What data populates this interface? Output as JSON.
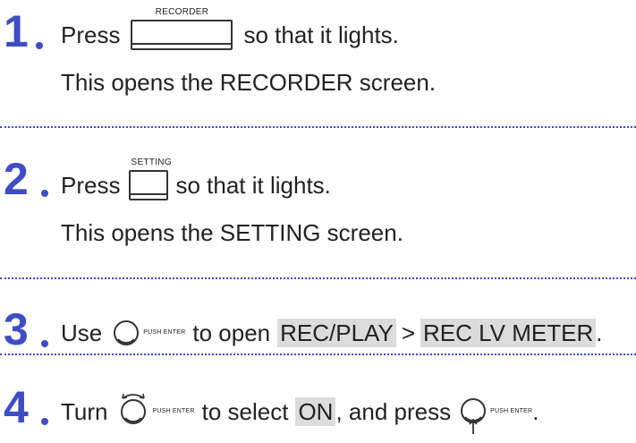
{
  "steps": [
    {
      "number": "1",
      "verb": "Press",
      "button_caption": "RECORDER",
      "suffix": "so that it lights.",
      "detail": "This opens the RECORDER screen."
    },
    {
      "number": "2",
      "verb": "Press",
      "button_caption": "SETTING",
      "suffix": "so that it lights.",
      "detail": "This opens the SETTING screen."
    },
    {
      "number": "3",
      "verb": "Use",
      "knob_caption": "PUSH ENTER",
      "middle": "to open",
      "menu_1": "REC/PLAY",
      "arrow": ">",
      "menu_2": "REC LV METER",
      "end": "."
    },
    {
      "number": "4",
      "verb": "Turn",
      "knob_caption": "PUSH ENTER",
      "middle": "to select",
      "option": "ON",
      "after_option": ", and press",
      "knob2_caption": "PUSH ENTER",
      "end": "."
    }
  ],
  "colors": {
    "accent": "#3e4dc4",
    "highlight": "#dcdcdc"
  },
  "icons": [
    "recorder-button-icon",
    "setting-button-icon",
    "dial-icon",
    "dial-turn-icon",
    "dial-push-icon"
  ]
}
